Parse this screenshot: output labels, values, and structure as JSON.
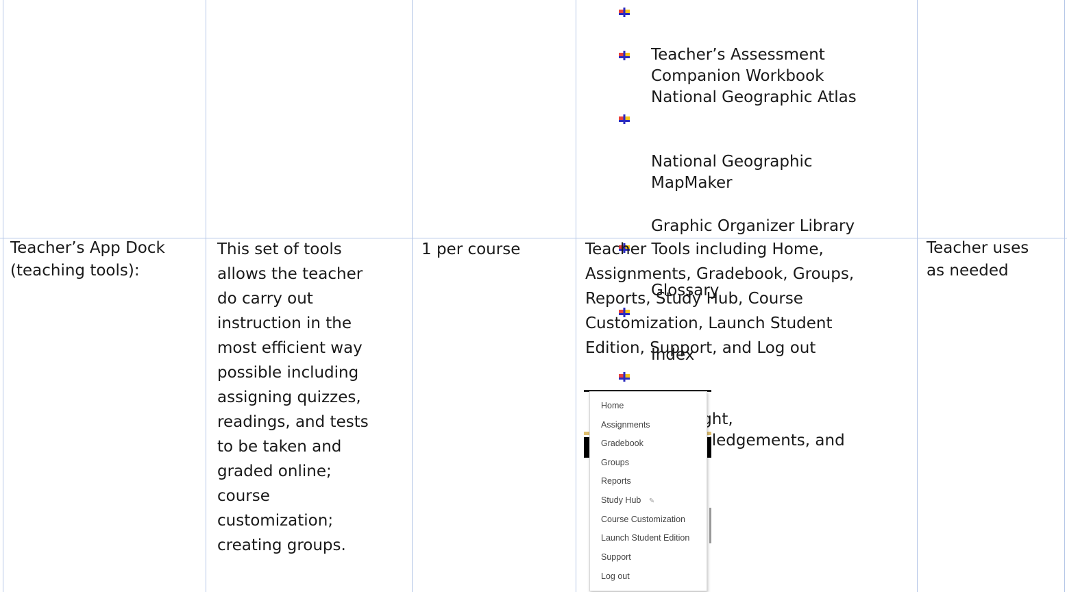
{
  "top_row": {
    "bullet_items": [
      "Teacher’s Assessment\nCompanion Workbook",
      "National Geographic Atlas",
      "National Geographic\nMapMaker",
      "Graphic Organizer Library",
      "Glossary",
      "Index",
      "Copyright,\nAcknowledgements, and\nCredits"
    ]
  },
  "bottom_row": {
    "component": "Teacher’s App Dock\n(teaching tools):",
    "description": "This set of tools\nallows the teacher\ndo carry out\ninstruction in the\nmost efficient way\npossible including\nassigning quizzes,\nreadings, and tests\nto be taken and\ngraded online;\ncourse\ncustomization;\ncreating groups.",
    "quantity": "1 per course",
    "details": "Teacher Tools including Home,\nAssignments, Gradebook, Groups,\nReports, Study Hub, Course\nCustomization, Launch Student\nEdition, Support, and Log out",
    "usage": "Teacher uses\nas needed",
    "menu_items": [
      "Home",
      "Assignments",
      "Gradebook",
      "Groups",
      "Reports",
      "Study Hub",
      "Course Customization",
      "Launch Student Edition",
      "Support",
      "Log out"
    ]
  },
  "colors": {
    "border": "#b4c6e7",
    "bullet_red": "#e8413c",
    "bullet_yellow": "#f5c518",
    "bullet_blue": "#2b2bbf"
  }
}
